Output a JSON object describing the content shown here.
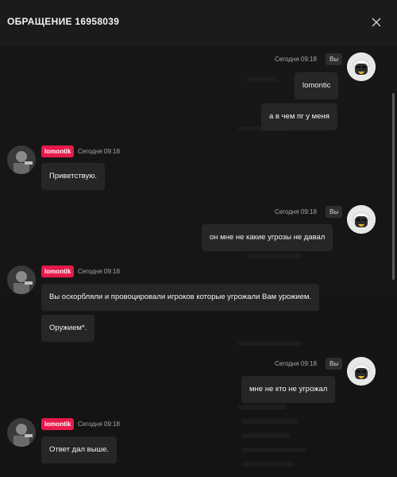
{
  "header": {
    "title": "ОБРАЩЕНИЕ 16958039"
  },
  "icons": {
    "close": "close-icon"
  },
  "messages": [
    {
      "from": "me",
      "badge": "Вы",
      "time": "Сегодня 09:18",
      "texts": [
        "lomontic",
        "а в чем пг у меня"
      ]
    },
    {
      "from": "other",
      "name": "lomontik",
      "time": "Сегодня 09:18",
      "texts": [
        "Приветствую."
      ]
    },
    {
      "from": "me",
      "badge": "Вы",
      "time": "Сегодня 09:18",
      "texts": [
        "он мне не какие угрозы не давал"
      ]
    },
    {
      "from": "other",
      "name": "lomontik",
      "time": "Сегодня 09:18",
      "texts": [
        "Вы оскорбляли и провоцировали игроков которые угрожали Вам урожием.",
        "Оружием*."
      ]
    },
    {
      "from": "me",
      "badge": "Вы",
      "time": "Сегодня 09:18",
      "texts": [
        "мне не кто не угрожал"
      ]
    },
    {
      "from": "other",
      "name": "lomontik",
      "time": "Сегодня 09:18",
      "texts": [
        "Ответ дал выше."
      ]
    }
  ],
  "colors": {
    "accent": "#e6194b",
    "bubble": "#262626",
    "background": "#151515"
  }
}
